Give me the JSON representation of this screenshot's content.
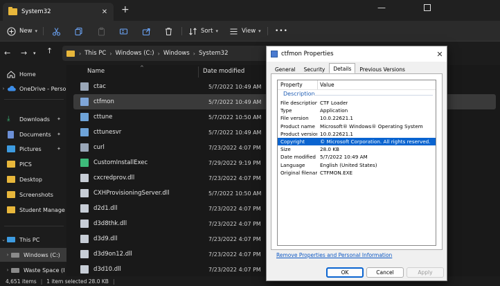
{
  "window": {
    "tab_title": "System32",
    "tab_close": "✕",
    "new_tab": "+",
    "minimize": "—"
  },
  "toolbar": {
    "new_label": "New",
    "sort_label": "Sort",
    "view_label": "View",
    "more": "•••"
  },
  "address": {
    "crumbs": [
      "This PC",
      "Windows (C:)",
      "Windows",
      "System32"
    ]
  },
  "sidebar": {
    "items": [
      {
        "label": "Home"
      },
      {
        "label": "OneDrive - Perso"
      },
      {
        "label": "Downloads"
      },
      {
        "label": "Documents"
      },
      {
        "label": "Pictures"
      },
      {
        "label": "PICS"
      },
      {
        "label": "Desktop"
      },
      {
        "label": "Screenshots"
      },
      {
        "label": "Student Manage"
      },
      {
        "label": "This PC"
      },
      {
        "label": "Windows (C:)"
      },
      {
        "label": "Waste Space (I"
      }
    ]
  },
  "filelist": {
    "col_name": "Name",
    "col_date": "Date modified",
    "rows": [
      {
        "name": "ctac",
        "date": "5/7/2022 10:49 AM"
      },
      {
        "name": "ctfmon",
        "date": "5/7/2022 10:49 AM"
      },
      {
        "name": "cttune",
        "date": "5/7/2022 10:50 AM"
      },
      {
        "name": "cttunesvr",
        "date": "5/7/2022 10:49 AM"
      },
      {
        "name": "curl",
        "date": "7/23/2022 4:07 PM"
      },
      {
        "name": "CustomInstallExec",
        "date": "7/29/2022 9:19 PM"
      },
      {
        "name": "cxcredprov.dll",
        "date": "7/23/2022 4:07 PM"
      },
      {
        "name": "CXHProvisioningServer.dll",
        "date": "5/7/2022 10:50 AM"
      },
      {
        "name": "d2d1.dll",
        "date": "7/23/2022 4:07 PM"
      },
      {
        "name": "d3d8thk.dll",
        "date": "7/23/2022 4:07 PM"
      },
      {
        "name": "d3d9.dll",
        "date": "7/23/2022 4:07 PM"
      },
      {
        "name": "d3d9on12.dll",
        "date": "7/23/2022 4:07 PM"
      },
      {
        "name": "d3d10.dll",
        "date": "7/23/2022 4:07 PM"
      }
    ]
  },
  "status": {
    "item_count": "4,651 items",
    "selection": "1 item selected  28.0 KB"
  },
  "dialog": {
    "title": "ctfmon Properties",
    "close": "✕",
    "tabs": [
      "General",
      "Security",
      "Details",
      "Previous Versions"
    ],
    "col_property": "Property",
    "col_value": "Value",
    "section": "Description",
    "properties": [
      {
        "key": "File description",
        "value": "CTF Loader"
      },
      {
        "key": "Type",
        "value": "Application"
      },
      {
        "key": "File version",
        "value": "10.0.22621.1"
      },
      {
        "key": "Product name",
        "value": "Microsoft® Windows® Operating System"
      },
      {
        "key": "Product version",
        "value": "10.0.22621.1"
      },
      {
        "key": "Copyright",
        "value": "© Microsoft Corporation. All rights reserved."
      },
      {
        "key": "Size",
        "value": "28.0 KB"
      },
      {
        "key": "Date modified",
        "value": "5/7/2022 10:49 AM"
      },
      {
        "key": "Language",
        "value": "English (United States)"
      },
      {
        "key": "Original filename",
        "value": "CTFMON.EXE"
      }
    ],
    "link": "Remove Properties and Personal Information",
    "ok": "OK",
    "cancel": "Cancel",
    "apply": "Apply"
  },
  "colors": {
    "folder": "#e8b73b",
    "accent": "#0a64d0",
    "link": "#0b57c4"
  }
}
